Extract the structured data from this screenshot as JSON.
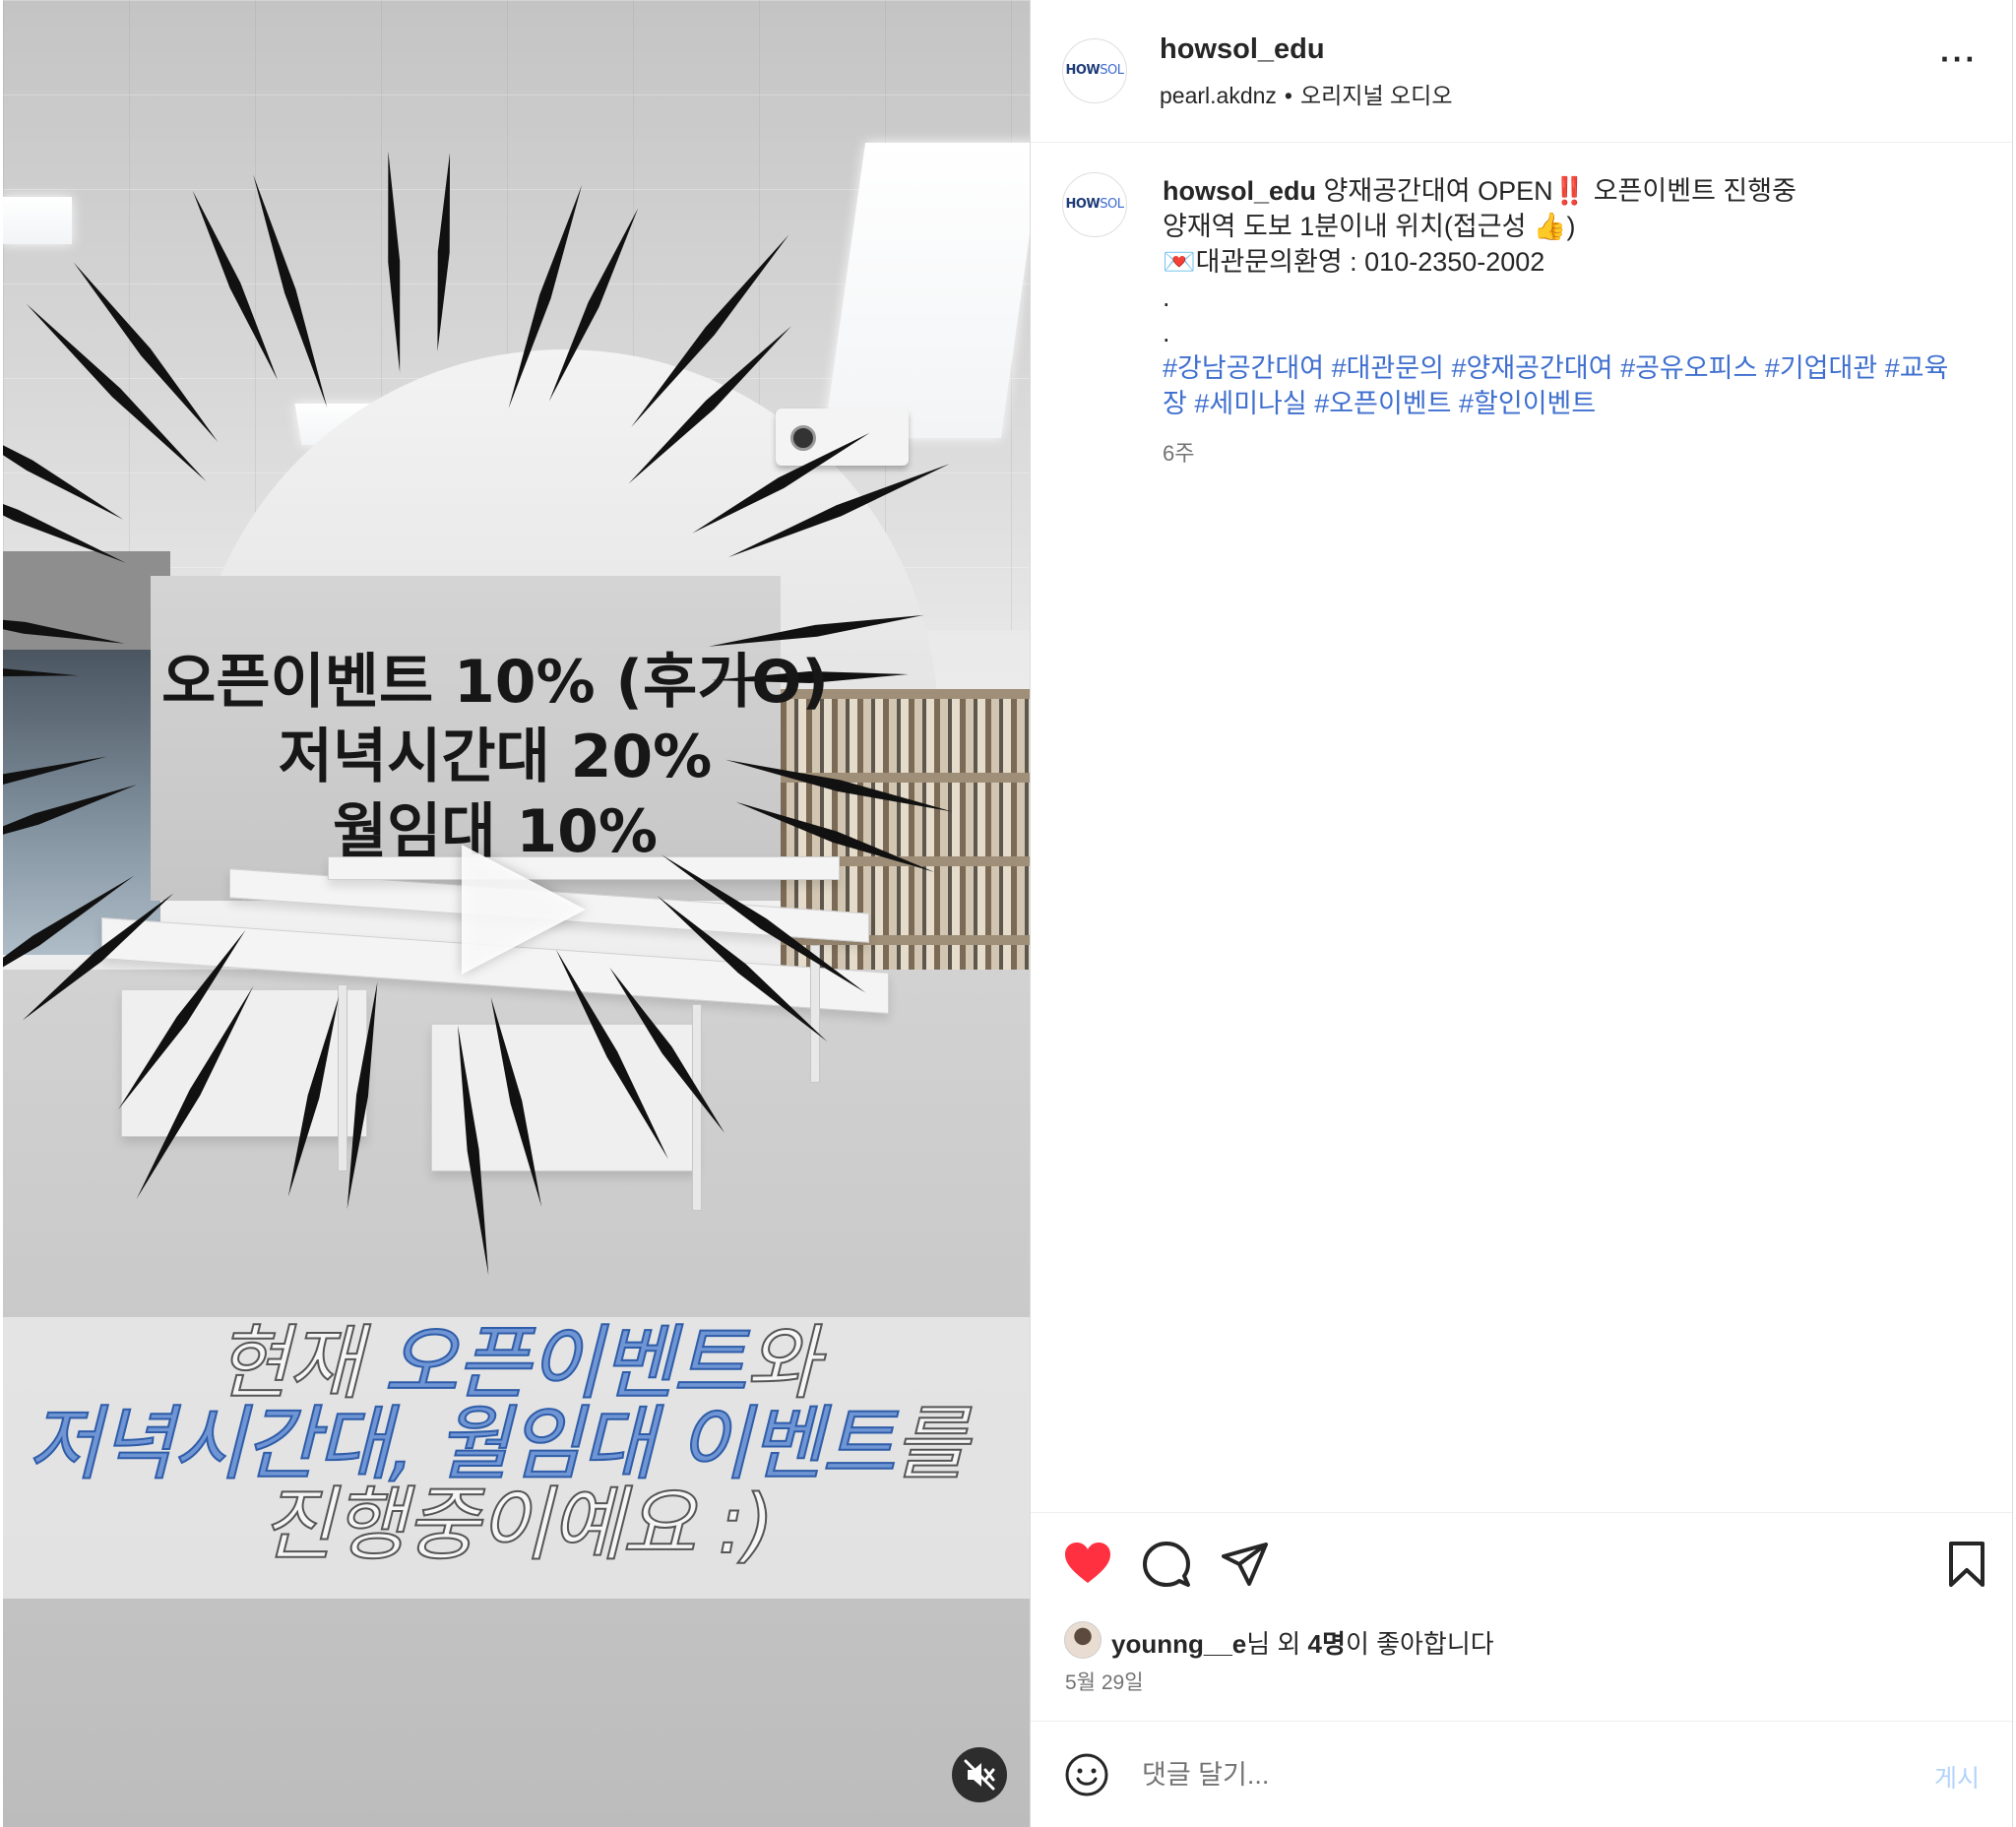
{
  "video": {
    "event_lines": [
      "오픈이벤트 10% (후기O)",
      "저녁시간대 20%",
      "월임대 10%"
    ],
    "caption": {
      "line1_gray": "현재 ",
      "line1_blue": "오픈이벤트",
      "line1_gray_end": "와",
      "line2_blue": "저녁시간대, 월임대 이벤트",
      "line2_gray": "를",
      "line3_gray": "진행중이예요 :)"
    },
    "play_icon": "play-icon",
    "mute_icon": "speaker-muted-icon"
  },
  "header": {
    "avatar_text": "HOW",
    "avatar_text_2": "SOL",
    "username": "howsol_edu",
    "audio_user": "pearl.akdnz",
    "separator": "•",
    "audio_label": "오리지널 오디오",
    "more_label": "···"
  },
  "post": {
    "username": "howsol_edu",
    "line1": "양재공간대여 OPEN‼️ 오픈이벤트 진행중",
    "line2": "양재역 도보 1분이내 위치(접근성 👍)",
    "line3": "💌대관문의환영 : 010-2350-2002",
    "dot1": ".",
    "dot2": ".",
    "hashtags": [
      "#강남공간대여",
      "#대관문의",
      "#양재공간대여",
      "#공유오피스",
      "#기업대관",
      "#교육장",
      "#세미나실",
      "#오픈이벤트",
      "#할인이벤트"
    ],
    "time_ago": "6주"
  },
  "actions": {
    "like_icon": "heart-filled-icon",
    "comment_icon": "comment-icon",
    "share_icon": "share-icon",
    "save_icon": "bookmark-icon",
    "like_color": "#ff3040"
  },
  "likes": {
    "user": "younng__e",
    "mid": "님 외 ",
    "count": "4명",
    "suffix": "이 좋아합니다",
    "date": "5월 29일"
  },
  "comment": {
    "placeholder": "댓글 달기...",
    "post_label": "게시",
    "emoji_icon": "smiley-icon"
  }
}
